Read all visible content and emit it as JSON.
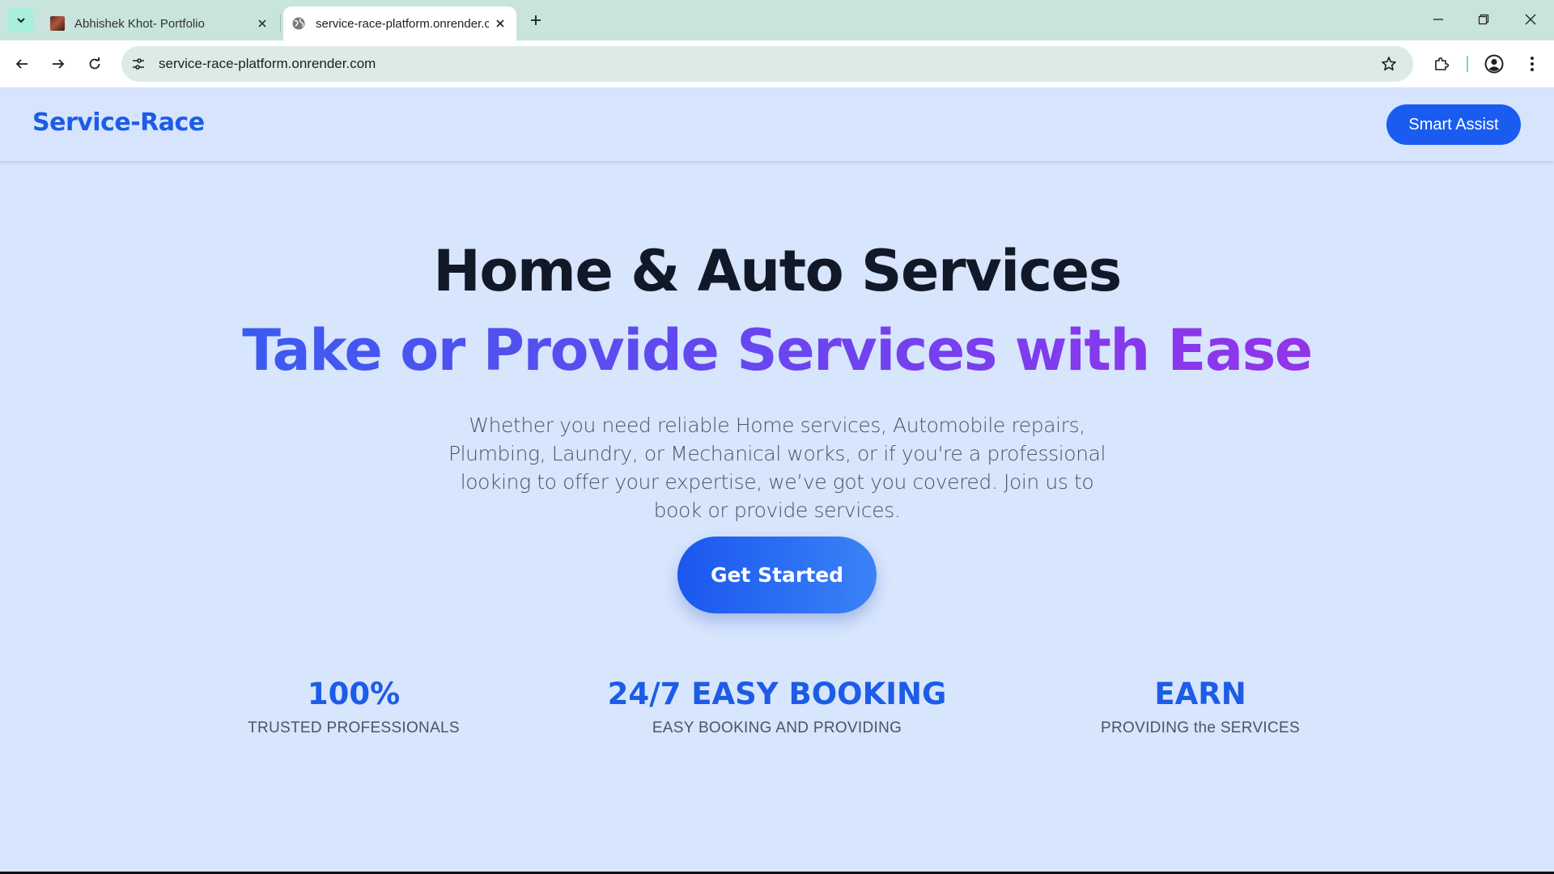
{
  "browser": {
    "tabs": [
      {
        "title": "Abhishek Khot- Portfolio",
        "active": false
      },
      {
        "title": "service-race-platform.onrender.com",
        "active": true
      }
    ],
    "url": "service-race-platform.onrender.com",
    "icons": {
      "tab_search": "chevron-down-icon",
      "close": "close-icon",
      "new_tab": "plus-icon",
      "back": "arrow-left-icon",
      "forward": "arrow-right-icon",
      "reload": "reload-icon",
      "site_info": "tune-icon",
      "bookmark": "star-icon",
      "extensions": "puzzle-icon",
      "profile": "profile-icon",
      "menu": "kebab-icon",
      "minimize": "minimize-icon",
      "restore": "restore-icon",
      "window_close": "close-icon"
    }
  },
  "navbar": {
    "brand": "Service-Race",
    "smart_assist": "Smart Assist"
  },
  "hero": {
    "title": "Home & Auto Services",
    "subtitle": "Take or Provide Services with Ease",
    "description": "Whether you need reliable Home services, Automobile repairs, Plumbing, Laundry, or Mechanical works, or if you're a professional looking to offer your expertise, we’ve got you covered. Join us to book or provide services.",
    "cta": "Get Started"
  },
  "stats": [
    {
      "value": "100%",
      "label": "TRUSTED PROFESSIONALS"
    },
    {
      "value": "24/7 EASY BOOKING",
      "label": "EASY BOOKING AND PROVIDING"
    },
    {
      "value": "EARN",
      "label": "PROVIDING the SERVICES"
    }
  ],
  "colors": {
    "brand_blue": "#1c5ce6",
    "page_background": "#d7e5fd",
    "gradient_start": "#3b5bf0",
    "gradient_end": "#9333ea"
  }
}
